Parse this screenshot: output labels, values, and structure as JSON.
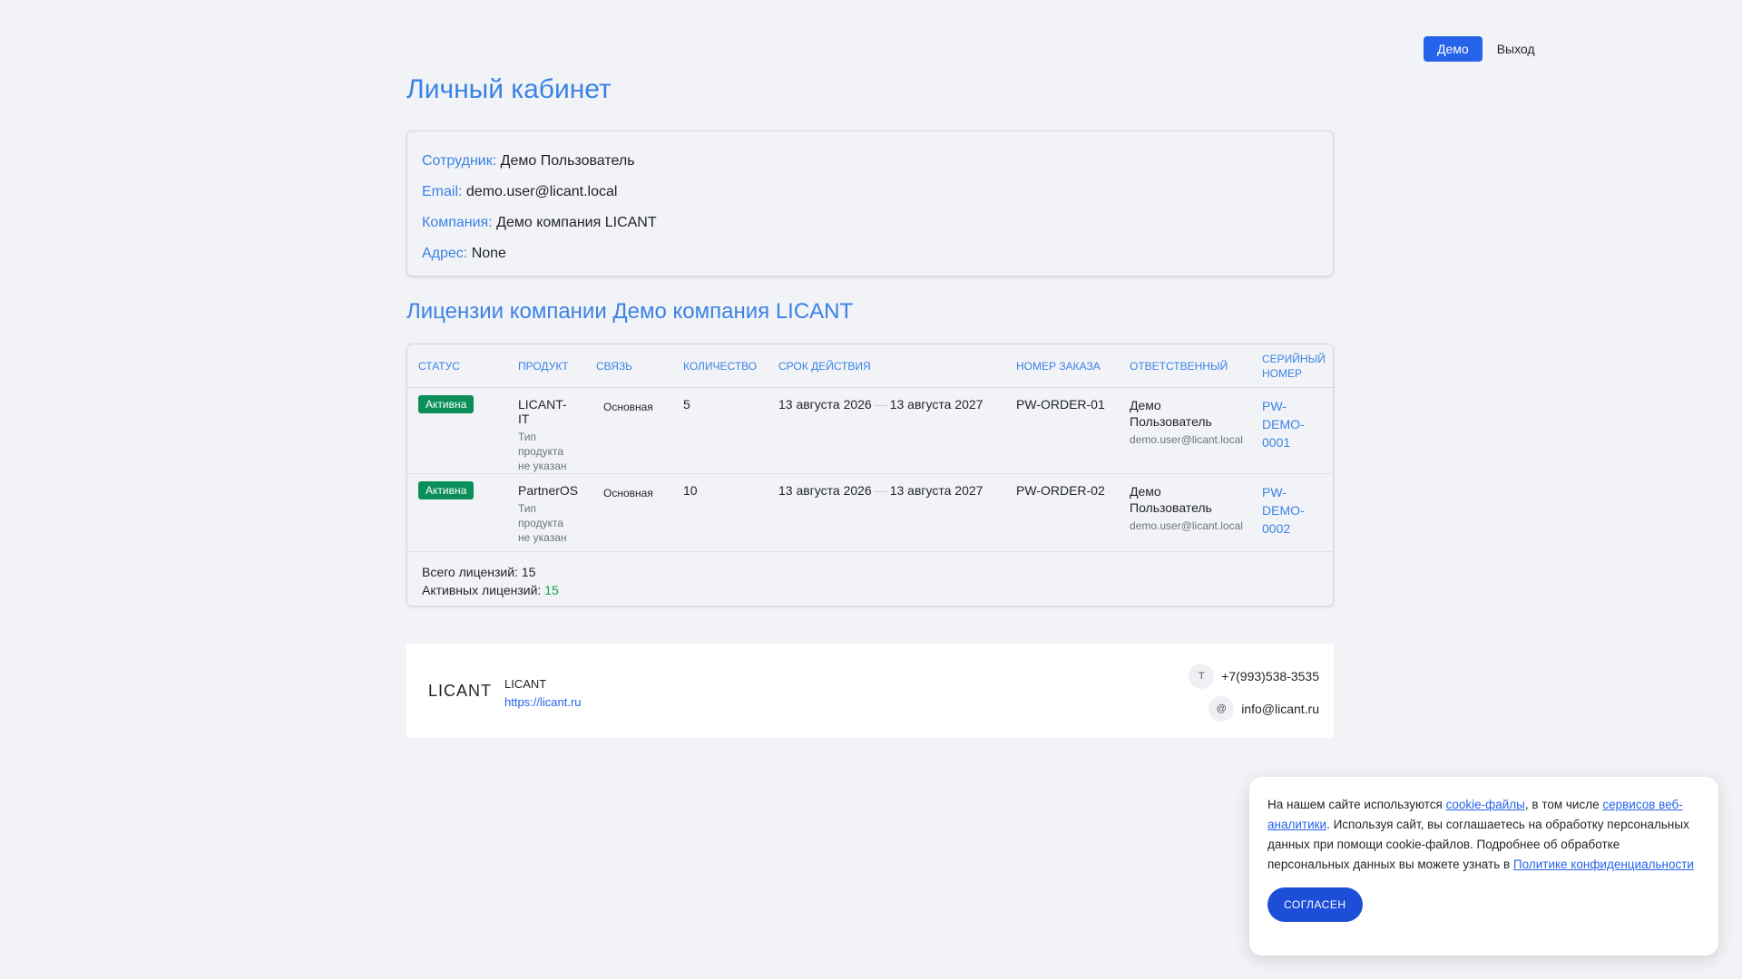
{
  "header": {
    "demo_label": "Демо",
    "exit_label": "Выход"
  },
  "page_title": "Личный кабинет",
  "profile": {
    "employee_label": "Сотрудник:",
    "employee_value": "Демо Пользователь",
    "email_label": "Email:",
    "email_value": "demo.user@licant.local",
    "company_label": "Компания:",
    "company_value": "Демо компания LICANT",
    "address_label": "Адрес:",
    "address_value": "None"
  },
  "licenses": {
    "title": "Лицензии компании Демо компания LICANT",
    "columns": {
      "status": "Статус",
      "product": "Продукт",
      "link": "Связь",
      "quantity": "Количество",
      "validity": "Срок действия",
      "order": "Номер заказа",
      "responsible": "Ответственный",
      "serial": "Серийный номер"
    },
    "rows": [
      {
        "status": "Активна",
        "product": "LICANT-IT",
        "product_type": "Тип продукта не указан",
        "link": "Основная",
        "quantity": "5",
        "date_from": "13 августа 2026",
        "date_sep": "—",
        "date_to": "13 августа 2027",
        "order": "PW-ORDER-01",
        "responsible_name": "Демо Пользователь",
        "responsible_email": "demo.user@licant.local",
        "serial": "PW-DEMO-0001"
      },
      {
        "status": "Активна",
        "product": "PartnerOS",
        "product_type": "Тип продукта не указан",
        "link": "Основная",
        "quantity": "10",
        "date_from": "13 августа 2026",
        "date_sep": "—",
        "date_to": "13 августа 2027",
        "order": "PW-ORDER-02",
        "responsible_name": "Демо Пользователь",
        "responsible_email": "demo.user@licant.local",
        "serial": "PW-DEMO-0002"
      }
    ],
    "total_label": "Всего лицензий:",
    "total_value": "15",
    "active_label": "Активных лицензий:",
    "active_value": "15"
  },
  "footer": {
    "logo": "LICANT",
    "company_name": "LICANT",
    "company_url": "https://licant.ru",
    "phone_icon": "T",
    "phone": "+7(993)538-3535",
    "email_icon": "@",
    "email": "info@licant.ru"
  },
  "cookie": {
    "text_1": "На нашем сайте используются ",
    "link_1": "cookie-файлы",
    "text_2": ", в том числе ",
    "link_2": "сервисов веб-аналитики",
    "text_3": ". Используя сайт, вы соглашаетесь на обработку персональных данных при помощи cookie-файлов. Подробнее об обработке персональных данных вы можете узнать в ",
    "link_3": "Политике конфиденциальности",
    "button": "СОГЛАСЕН"
  },
  "colors": {
    "accent": "#3b82e6",
    "primary_button": "#2563eb",
    "badge_active": "#0a8f5b",
    "active_count": "#16a34a",
    "background": "#f2f3f6"
  }
}
